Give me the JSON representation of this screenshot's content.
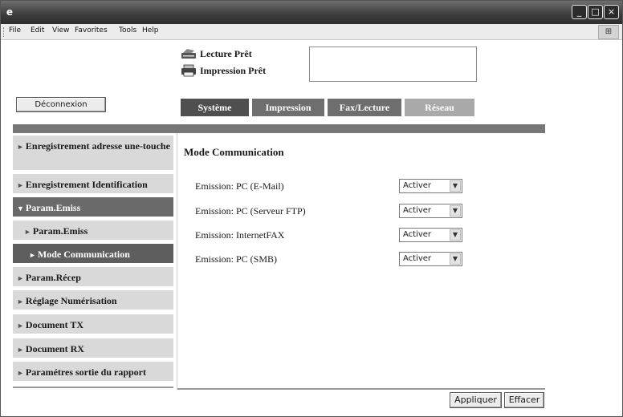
{
  "window": {
    "menu": [
      "File",
      "Edit",
      "View",
      "Favorites",
      "Tools",
      "Help"
    ]
  },
  "header": {
    "status_scan": "Lecture Prêt",
    "status_print": "Impression Prêt",
    "logout_label": "Déconnexion",
    "tabs": [
      "Système",
      "Impression",
      "Fax/Lecture",
      "Réseau"
    ]
  },
  "sidebar": {
    "items": [
      {
        "label": "Enregistrement adresse une-touche"
      },
      {
        "label": "Enregistrement Identification"
      },
      {
        "label": "Param.Emiss"
      },
      {
        "label": "Param.Emiss"
      },
      {
        "label": "Mode Communication"
      },
      {
        "label": "Param.Récep"
      },
      {
        "label": "Réglage Numérisation"
      },
      {
        "label": "Document TX"
      },
      {
        "label": "Document RX"
      },
      {
        "label": "Paramétres sortie du rapport"
      }
    ]
  },
  "main": {
    "title": "Mode Communication",
    "rows": [
      {
        "label": "Emission: PC (E-Mail)",
        "value": "Activer"
      },
      {
        "label": "Emission: PC (Serveur FTP)",
        "value": "Activer"
      },
      {
        "label": "Emission: InternetFAX",
        "value": "Activer"
      },
      {
        "label": "Emission: PC (SMB)",
        "value": "Activer"
      }
    ]
  },
  "actions": {
    "apply_label": "Appliquer",
    "clear_label": "Effacer"
  }
}
